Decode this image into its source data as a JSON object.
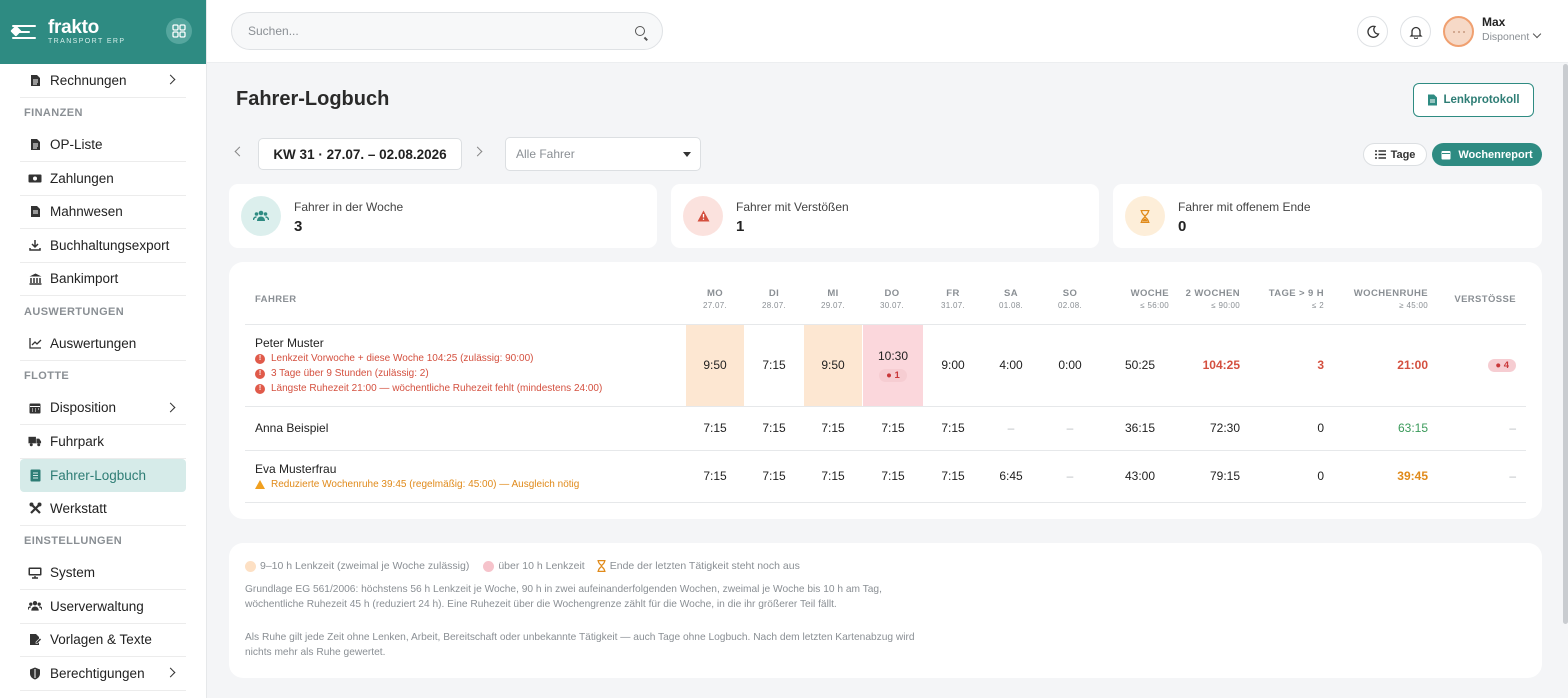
{
  "app": {
    "name": "frakto",
    "subtitle": "TRANSPORT ERP"
  },
  "header": {
    "search_placeholder": "Suchen...",
    "user_name": "Max",
    "user_role": "Disponent"
  },
  "sidebar": {
    "items": [
      {
        "label": "Rechnungen",
        "icon": "document-icon"
      },
      {
        "section": "FINANZEN"
      },
      {
        "label": "OP-Liste",
        "icon": "document-icon"
      },
      {
        "label": "Zahlungen",
        "icon": "money-icon"
      },
      {
        "label": "Mahnwesen",
        "icon": "document-icon"
      },
      {
        "label": "Buchhaltungsexport",
        "icon": "download-icon"
      },
      {
        "label": "Bankimport",
        "icon": "bank-icon"
      },
      {
        "section": "AUSWERTUNGEN"
      },
      {
        "label": "Auswertungen",
        "icon": "chart-icon"
      },
      {
        "section": "FLOTTE"
      },
      {
        "label": "Disposition",
        "icon": "calendar-icon"
      },
      {
        "label": "Fuhrpark",
        "icon": "truck-icon"
      },
      {
        "label": "Fahrer-Logbuch",
        "icon": "logbook-icon"
      },
      {
        "label": "Werkstatt",
        "icon": "tools-icon"
      },
      {
        "section": "EINSTELLUNGEN"
      },
      {
        "label": "System",
        "icon": "monitor-icon"
      },
      {
        "label": "Userverwaltung",
        "icon": "users-icon"
      },
      {
        "label": "Vorlagen & Texte",
        "icon": "template-icon"
      },
      {
        "label": "Berechtigungen",
        "icon": "shield-icon"
      }
    ]
  },
  "page": {
    "title": "Fahrer-Logbuch",
    "lenk_button": "Lenkprotokoll",
    "week_label": "KW 31 · 27.07. – 02.08.2026",
    "driver_filter": "Alle Fahrer",
    "view_tage": "Tage",
    "view_woche": "Wochenreport"
  },
  "stats": [
    {
      "label": "Fahrer in der Woche",
      "value": "3"
    },
    {
      "label": "Fahrer mit Verstößen",
      "value": "1"
    },
    {
      "label": "Fahrer mit offenem Ende",
      "value": "0"
    }
  ],
  "table": {
    "headers": [
      {
        "label": "FAHRER",
        "sub": ""
      },
      {
        "label": "MO",
        "sub": "27.07."
      },
      {
        "label": "DI",
        "sub": "28.07."
      },
      {
        "label": "MI",
        "sub": "29.07."
      },
      {
        "label": "DO",
        "sub": "30.07."
      },
      {
        "label": "FR",
        "sub": "31.07."
      },
      {
        "label": "SA",
        "sub": "01.08."
      },
      {
        "label": "SO",
        "sub": "02.08."
      },
      {
        "label": "WOCHE",
        "sub": "≤ 56:00"
      },
      {
        "label": "2 WOCHEN",
        "sub": "≤ 90:00"
      },
      {
        "label": "TAGE > 9 H",
        "sub": "≤ 2"
      },
      {
        "label": "WOCHENRUHE",
        "sub": "≥ 45:00"
      },
      {
        "label": "VERSTÖSSE",
        "sub": ""
      }
    ],
    "rows": [
      {
        "name": "Peter Muster",
        "warnings": [
          "Lenkzeit Vorwoche + diese Woche 104:25 (zulässig: 90:00)",
          "3 Tage über 9 Stunden (zulässig: 2)",
          "Längste Ruhezeit 21:00 — wöchentliche Ruhezeit fehlt (mindestens 24:00)"
        ],
        "days": [
          "9:50",
          "7:15",
          "9:50",
          "10:30",
          "9:00",
          "4:00",
          "0:00"
        ],
        "do_badge": "● 1",
        "woche": "50:25",
        "zwei_wochen": "104:25",
        "tage9": "3",
        "wochenruhe": "21:00",
        "verstoesse": "● 4"
      },
      {
        "name": "Anna Beispiel",
        "days": [
          "7:15",
          "7:15",
          "7:15",
          "7:15",
          "7:15",
          "–",
          "–"
        ],
        "woche": "36:15",
        "zwei_wochen": "72:30",
        "tage9": "0",
        "wochenruhe": "63:15",
        "verstoesse": "–"
      },
      {
        "name": "Eva Musterfrau",
        "warnings": [
          "Reduzierte Wochenruhe 39:45 (regelmäßig: 45:00) — Ausgleich nötig"
        ],
        "days": [
          "7:15",
          "7:15",
          "7:15",
          "7:15",
          "7:15",
          "6:45",
          "–"
        ],
        "woche": "43:00",
        "zwei_wochen": "79:15",
        "tage9": "0",
        "wochenruhe": "39:45",
        "verstoesse": "–"
      }
    ]
  },
  "legend": {
    "items": [
      "9–10 h Lenkzeit (zweimal je Woche zulässig)",
      "über 10 h Lenkzeit",
      "Ende der letzten Tätigkeit steht noch aus"
    ],
    "note1": "Grundlage EG 561/2006: höchstens 56 h Lenkzeit je Woche, 90 h in zwei aufeinanderfolgenden Wochen, zweimal je Woche bis 10 h am Tag, wöchentliche Ruhezeit 45 h (reduziert 24 h). Eine Ruhezeit über die Wochengrenze zählt für die Woche, in die ihr größerer Teil fällt.",
    "note2": "Als Ruhe gilt jede Zeit ohne Lenken, Arbeit, Bereitschaft oder unbekannte Tätigkeit — auch Tage ohne Logbuch. Nach dem letzten Kartenabzug wird nichts mehr als Ruhe gewertet."
  },
  "colors": {
    "accent": "#2e8b82",
    "danger": "#d4503f",
    "warning": "#e08a1a",
    "success": "#3a9a5a",
    "hl_orange": "#fde7d2",
    "hl_red": "#fbd7dc"
  }
}
